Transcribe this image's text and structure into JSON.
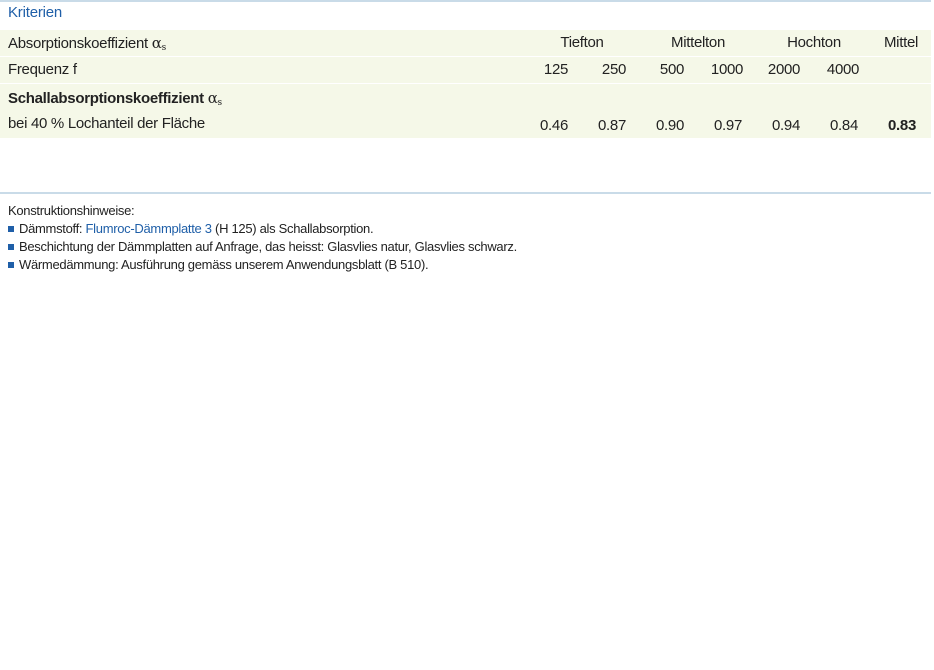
{
  "table": {
    "title": "Kriterien",
    "row1": {
      "label": "Absorptionskoeffizient",
      "alpha": "α",
      "sub": "s",
      "groups": [
        "Tiefton",
        "Mittelton",
        "Hochton",
        "Mittel"
      ]
    },
    "row2": {
      "label": "Frequenz f",
      "frequencies": [
        "125",
        "250",
        "500",
        "1000",
        "2000",
        "4000"
      ]
    },
    "row3": {
      "label": "Schallabsorptionskoeffizient",
      "alpha": "α",
      "sub": "s"
    },
    "row4": {
      "label": "bei 40 % Lochanteil der Fläche",
      "values": [
        "0.46",
        "0.87",
        "0.90",
        "0.97",
        "0.94",
        "0.84"
      ],
      "mean": "0.83"
    }
  },
  "notes": {
    "heading": "Konstruktionshinweise:",
    "items": [
      {
        "prefix": "Dämmstoff: ",
        "link": "Flumroc-Dämmplatte 3",
        "suffix": " (H 125) als Schallabsorption."
      },
      {
        "text": "Beschichtung der Dämmplatten auf Anfrage, das heisst: Glasvlies natur, Glasvlies schwarz."
      },
      {
        "text": "Wärmedämmung: Ausführung gemäss unserem Anwendungsblatt (B 510)."
      }
    ]
  },
  "colors": {
    "accent": "#1f5fa8",
    "row_background": "#f5f8e8",
    "rule": "#c9dbe8"
  }
}
